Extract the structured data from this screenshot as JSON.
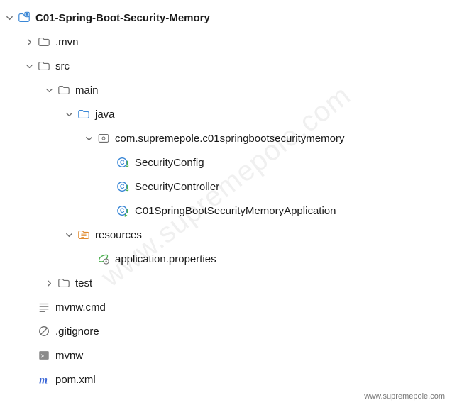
{
  "watermark": "www.supremepole.com",
  "footer": "www.supremepole.com",
  "tree": {
    "root": {
      "label": "C01-Spring-Boot-Security-Memory",
      "mvn": ".mvn",
      "src": {
        "label": "src",
        "main": {
          "label": "main",
          "java": {
            "label": "java",
            "pkg": {
              "label": "com.supremepole.c01springbootsecuritymemory",
              "c1": "SecurityConfig",
              "c2": "SecurityController",
              "c3": "C01SpringBootSecurityMemoryApplication"
            }
          },
          "resources": {
            "label": "resources",
            "props": "application.properties"
          }
        },
        "test": "test"
      },
      "mvnwcmd": "mvnw.cmd",
      "gitignore": ".gitignore",
      "mvnw": "mvnw",
      "pom": "pom.xml"
    }
  }
}
